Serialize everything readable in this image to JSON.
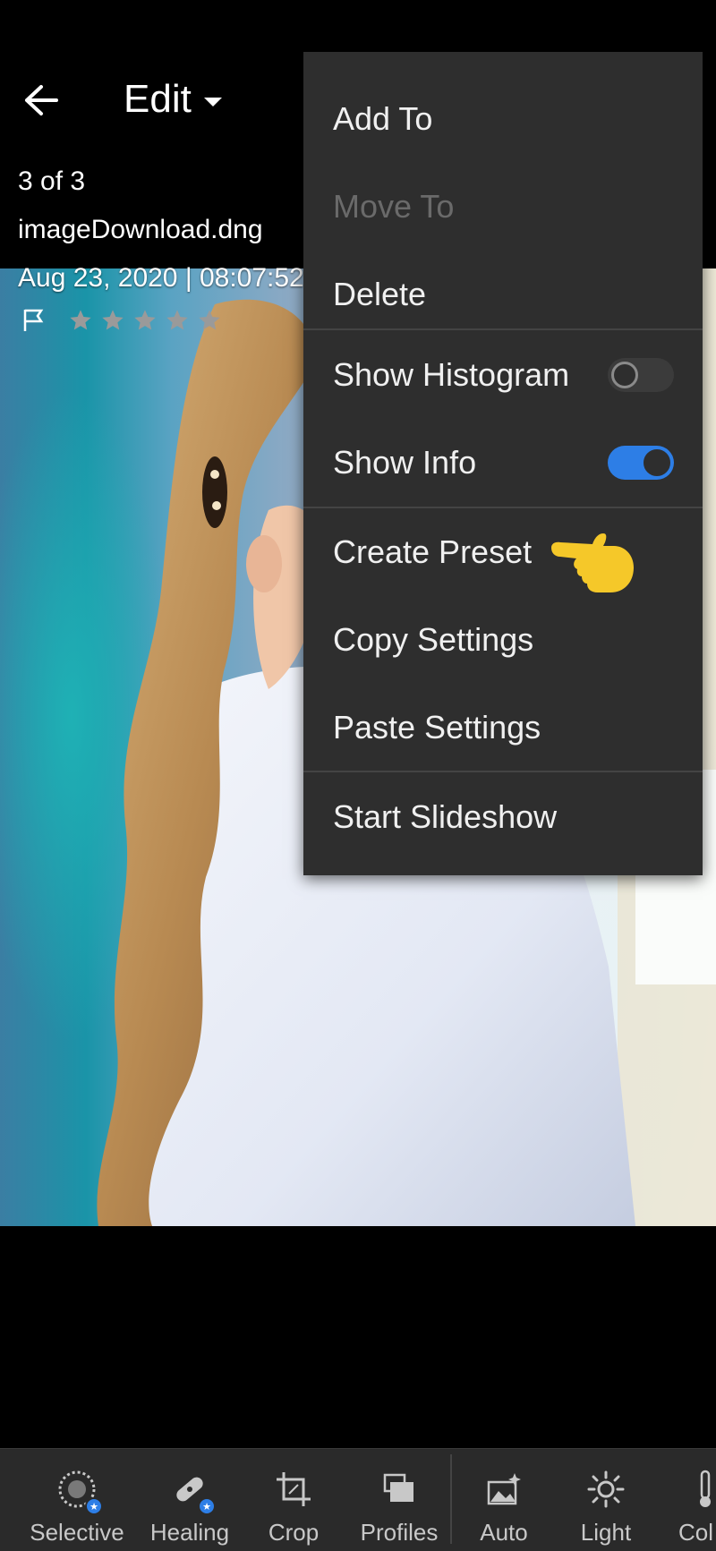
{
  "header": {
    "title": "Edit",
    "back_icon": "arrow-left-icon",
    "dropdown_icon": "caret-down-icon"
  },
  "photo_info": {
    "count": "3 of 3",
    "filename": "imageDownload.dng",
    "datetime": "Aug 23, 2020 | 08:07:52",
    "rating": 0,
    "max_rating": 5
  },
  "menu": {
    "items": [
      {
        "label": "Add To",
        "enabled": true
      },
      {
        "label": "Move To",
        "enabled": false
      },
      {
        "label": "Delete",
        "enabled": true
      },
      {
        "label": "Show Histogram",
        "enabled": true,
        "toggle": false
      },
      {
        "label": "Show Info",
        "enabled": true,
        "toggle": true
      },
      {
        "label": "Create Preset",
        "enabled": true
      },
      {
        "label": "Copy Settings",
        "enabled": true
      },
      {
        "label": "Paste Settings",
        "enabled": true
      },
      {
        "label": "Start Slideshow",
        "enabled": true
      }
    ]
  },
  "toolbar": {
    "tools": [
      {
        "label": "Selective",
        "icon": "selective-icon"
      },
      {
        "label": "Healing",
        "icon": "healing-bandage-icon"
      },
      {
        "label": "Crop",
        "icon": "crop-icon"
      },
      {
        "label": "Profiles",
        "icon": "profiles-icon"
      },
      {
        "label": "Auto",
        "icon": "auto-icon"
      },
      {
        "label": "Light",
        "icon": "sun-icon"
      },
      {
        "label": "Col",
        "icon": "thermometer-icon"
      }
    ]
  },
  "colors": {
    "menu_bg": "#2e2e2e",
    "toggle_on": "#2d7ee6",
    "pointer": "#f5c829",
    "toolbar_bg": "#2a2a2a"
  }
}
